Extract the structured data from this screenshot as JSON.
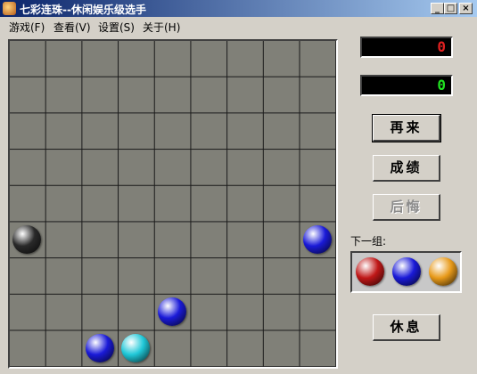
{
  "window": {
    "title": "七彩连珠--休闲娱乐级选手",
    "controls": [
      "_",
      "□",
      "×"
    ]
  },
  "menu": [
    {
      "label": "游戏(F)"
    },
    {
      "label": "查看(V)"
    },
    {
      "label": "设置(S)"
    },
    {
      "label": "关于(H)"
    }
  ],
  "board": {
    "size": 9,
    "balls": [
      {
        "row": 5,
        "col": 0,
        "color": "black"
      },
      {
        "row": 5,
        "col": 8,
        "color": "blue"
      },
      {
        "row": 7,
        "col": 4,
        "color": "blue"
      },
      {
        "row": 8,
        "col": 2,
        "color": "blue"
      },
      {
        "row": 8,
        "col": 3,
        "color": "cyan"
      }
    ]
  },
  "scores": {
    "red": "0",
    "green": "0"
  },
  "buttons": {
    "again": "再来",
    "results": "成绩",
    "undo": "后悔",
    "rest": "休息"
  },
  "next": {
    "label": "下一组:",
    "balls": [
      "red",
      "blue",
      "orange"
    ]
  },
  "colors": {
    "black": "#2a2a2a",
    "blue": "#1a1ad8",
    "cyan": "#20c8d8",
    "red": "#c01818",
    "orange": "#e89a1a"
  }
}
